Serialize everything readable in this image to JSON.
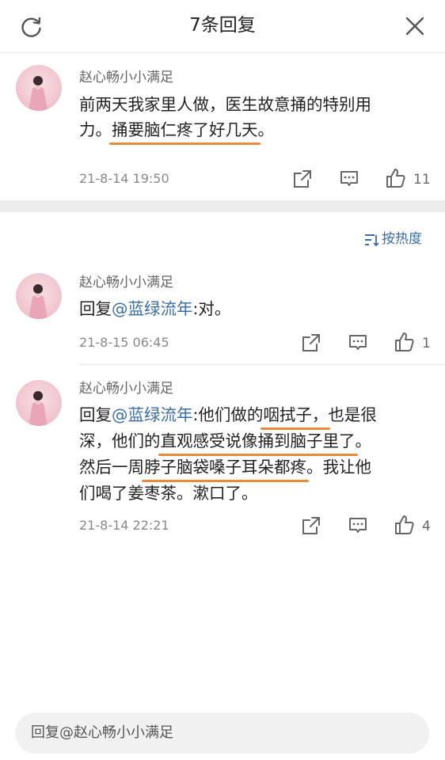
{
  "header": {
    "title": "7条回复",
    "refresh_icon": "refresh-icon",
    "close_icon": "close-icon"
  },
  "top_comment": {
    "username": "赵心畅小小满足",
    "text_pre": "前两天我家里人做，医生故意捅的特别用",
    "text_line2_pre": "力。",
    "text_underlined": "捅要脑仁疼了好几天",
    "text_line2_post": "。",
    "date": "21-8-14 19:50",
    "likes": "11"
  },
  "sort": {
    "label": "按热度",
    "icon": "sort-icon"
  },
  "replies": [
    {
      "username": "赵心畅小小满足",
      "prefix": "回复",
      "mention": "@蓝绿流年",
      "text": ":对。",
      "date": "21-8-15 06:45",
      "likes": "1"
    },
    {
      "username": "赵心畅小小满足",
      "prefix": "回复",
      "mention": "@蓝绿流年",
      "line1_a": ":他们做的",
      "line1_ul": "咽拭子，",
      "line1_b": "也是很",
      "line2_a": "深，他们的",
      "line2_ul": "直观感受说像捅到脑子里了",
      "line2_b": "。",
      "line3_a": "然后一周",
      "line3_ul": "脖子脑袋嗓子耳朵都疼",
      "line3_b": "。我让他",
      "line4": "们喝了姜枣茶。漱口了。",
      "date": "21-8-14 22:21",
      "likes": "4"
    }
  ],
  "reply_bar": {
    "placeholder": "回复@赵心畅小小满足"
  },
  "colors": {
    "accent_link": "#3b6ea5",
    "underline": "#e88a3b",
    "separator": "#ececec"
  }
}
